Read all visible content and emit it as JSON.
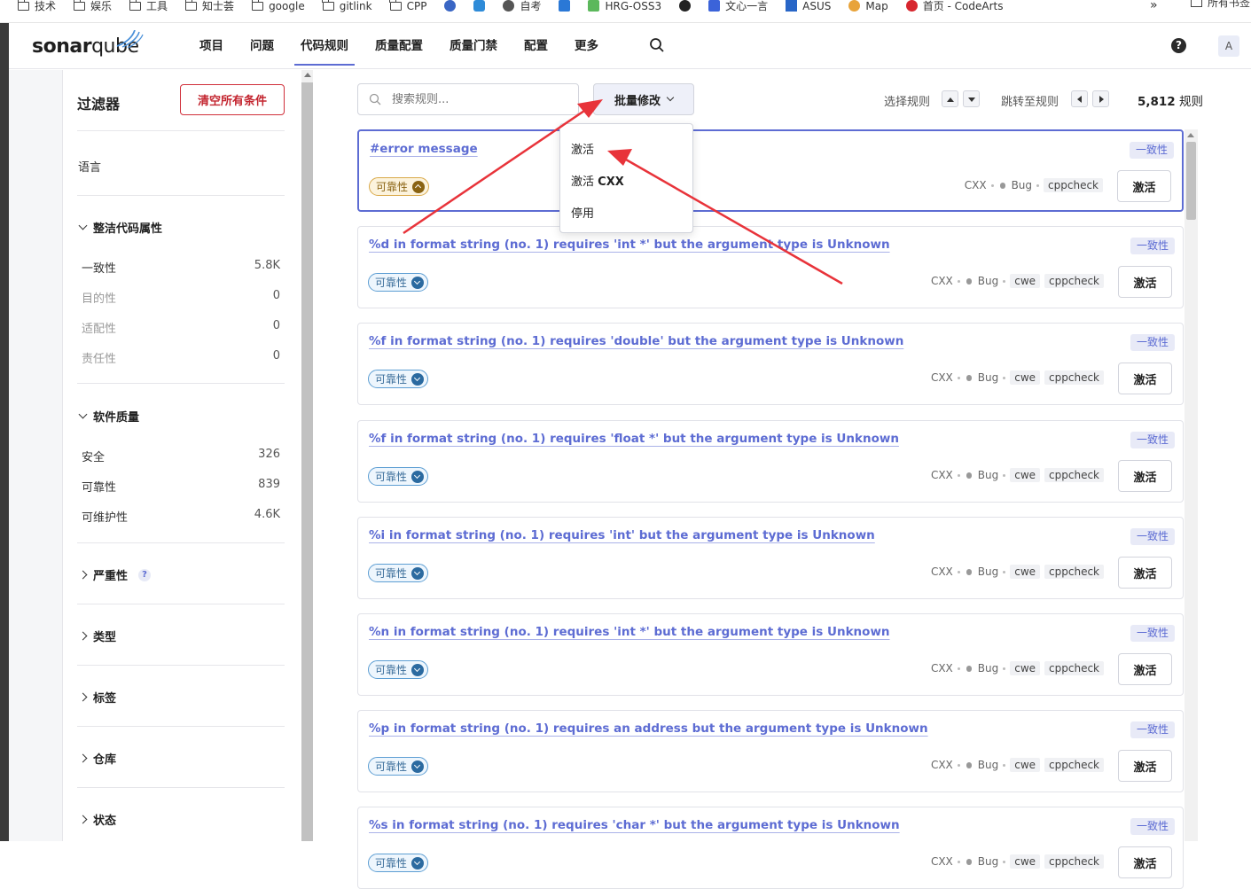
{
  "bookmarks": [
    "技术",
    "娱乐",
    "工具",
    "知士荟",
    "google",
    "gitlink",
    "CPP",
    "",
    "",
    "自考",
    "",
    "HRG-OSS3",
    "",
    "文心一言",
    "ASUS",
    "Map",
    "首页 - CodeArts"
  ],
  "bookmarks_more": "»",
  "bookmarks_all": "所有书签",
  "header": {
    "logo_bold": "sonar",
    "logo_rest": "qube",
    "nav": [
      "项目",
      "问题",
      "代码规则",
      "质量配置",
      "质量门禁",
      "配置",
      "更多"
    ],
    "active_nav": "代码规则",
    "help": "?",
    "avatar": "A"
  },
  "sidebar": {
    "title": "过滤器",
    "clear_label": "清空所有条件",
    "language_label": "语言",
    "clean_code": {
      "label": "整洁代码属性",
      "items": [
        {
          "label": "一致性",
          "count": "5.8K"
        },
        {
          "label": "目的性",
          "count": "0"
        },
        {
          "label": "适配性",
          "count": "0"
        },
        {
          "label": "责任性",
          "count": "0"
        }
      ]
    },
    "software_quality": {
      "label": "软件质量",
      "items": [
        {
          "label": "安全",
          "count": "326"
        },
        {
          "label": "可靠性",
          "count": "839"
        },
        {
          "label": "可维护性",
          "count": "4.6K"
        }
      ]
    },
    "collapsed": [
      "严重性",
      "类型",
      "标签",
      "仓库",
      "状态"
    ],
    "severity_help": "?"
  },
  "toolbar": {
    "search_placeholder": "搜索规则...",
    "bulk_label": "批量修改",
    "select_label": "选择规则",
    "jump_label": "跳转至规则",
    "total_count": "5,812",
    "total_unit": "规则"
  },
  "dropdown": {
    "items": [
      "激活",
      "激活",
      "停用"
    ],
    "activate_lang": "CXX"
  },
  "rules": [
    {
      "title": "#error message",
      "quality": "可靠性",
      "consistency": "一致性",
      "lang": "CXX",
      "type": "Bug",
      "tags": [
        "cppcheck"
      ],
      "action": "激活"
    },
    {
      "title": "%d in format string (no. 1) requires 'int *' but the argument type is Unknown",
      "quality": "可靠性",
      "consistency": "一致性",
      "lang": "CXX",
      "type": "Bug",
      "tags": [
        "cwe",
        "cppcheck"
      ],
      "action": "激活"
    },
    {
      "title": "%f in format string (no. 1) requires 'double' but the argument type is Unknown",
      "quality": "可靠性",
      "consistency": "一致性",
      "lang": "CXX",
      "type": "Bug",
      "tags": [
        "cwe",
        "cppcheck"
      ],
      "action": "激活"
    },
    {
      "title": "%f in format string (no. 1) requires 'float *' but the argument type is Unknown",
      "quality": "可靠性",
      "consistency": "一致性",
      "lang": "CXX",
      "type": "Bug",
      "tags": [
        "cwe",
        "cppcheck"
      ],
      "action": "激活"
    },
    {
      "title": "%i in format string (no. 1) requires 'int' but the argument type is Unknown",
      "quality": "可靠性",
      "consistency": "一致性",
      "lang": "CXX",
      "type": "Bug",
      "tags": [
        "cwe",
        "cppcheck"
      ],
      "action": "激活"
    },
    {
      "title": "%n in format string (no. 1) requires 'int *' but the argument type is Unknown",
      "quality": "可靠性",
      "consistency": "一致性",
      "lang": "CXX",
      "type": "Bug",
      "tags": [
        "cwe",
        "cppcheck"
      ],
      "action": "激活"
    },
    {
      "title": "%p in format string (no. 1) requires an address but the argument type is Unknown",
      "quality": "可靠性",
      "consistency": "一致性",
      "lang": "CXX",
      "type": "Bug",
      "tags": [
        "cwe",
        "cppcheck"
      ],
      "action": "激活"
    },
    {
      "title": "%s in format string (no. 1) requires 'char *' but the argument type is Unknown",
      "quality": "可靠性",
      "consistency": "一致性",
      "lang": "CXX",
      "type": "Bug",
      "tags": [
        "cwe",
        "cppcheck"
      ],
      "action": "激活"
    }
  ],
  "colors": {
    "accent": "#5d6cd3",
    "danger": "#c3252f",
    "annotation": "#e8333a"
  }
}
